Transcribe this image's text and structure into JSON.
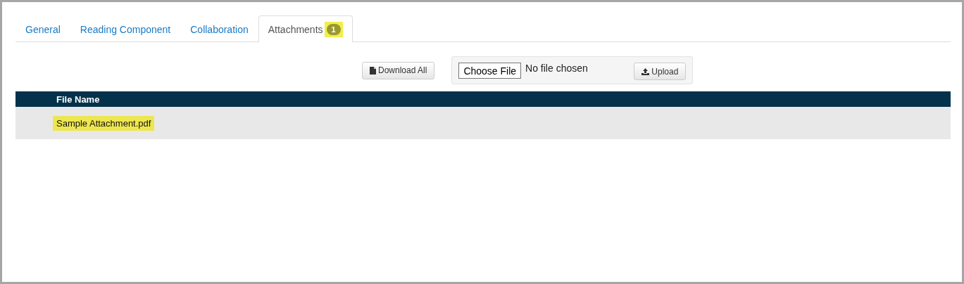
{
  "tabs": [
    {
      "label": "General",
      "selected": false
    },
    {
      "label": "Reading Component",
      "selected": false
    },
    {
      "label": "Collaboration",
      "selected": false
    },
    {
      "label": "Attachments",
      "selected": true,
      "badge": "1",
      "badge_highlighted": true
    }
  ],
  "toolbar": {
    "download_button": "Download All",
    "choose_button": "Choose File",
    "file_status": "No file chosen",
    "upload_button": "Upload"
  },
  "table": {
    "columns": [
      "File Name"
    ],
    "rows": [
      {
        "file_name": "Sample Attachment.pdf",
        "highlighted": true
      }
    ]
  }
}
